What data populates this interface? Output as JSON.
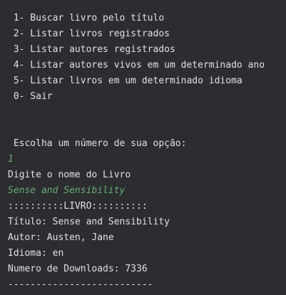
{
  "console": {
    "menu": [
      " 1- Buscar livro pelo título",
      " 2- Listar livros registrados",
      " 3- Listar autores registrados",
      " 4- Listar autores vivos em um determinado ano",
      " 5- Listar livros em um determinado idioma",
      " 0- Sair"
    ],
    "prompt": " Escolha um número de sua opção:",
    "user_choice": "1",
    "ask_title": "Digite o nome do Livro",
    "user_title": "Sense and Sensibility",
    "book_header": "::::::::::LIVRO::::::::::",
    "book_title_line": "Título: Sense and Sensibility",
    "book_author_line": "Autor: Austen, Jane",
    "book_language_line": "Idioma: en",
    "book_downloads_line": "Numero de Downloads: 7336",
    "separator": "--------------------------"
  },
  "colors": {
    "background": "#2b2d30",
    "text": "#dfe1e5",
    "user_input": "#6aab73"
  }
}
